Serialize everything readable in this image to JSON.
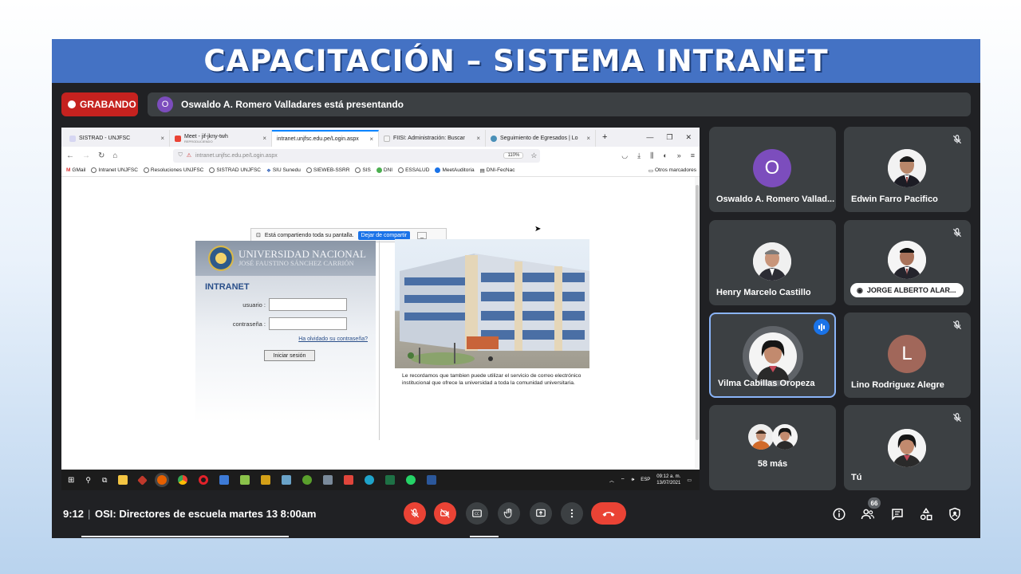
{
  "banner": {
    "title": "CAPACITACIÓN – SISTEMA INTRANET"
  },
  "meet": {
    "recording_label": "GRABANDO",
    "presenter_initial": "O",
    "presenter_text": "Oswaldo A. Romero Valladares está presentando",
    "time": "9:12",
    "divider": "|",
    "meeting_title": "OSI: Directores de escuela martes 13 8:00am",
    "participant_count": "66",
    "colors": {
      "background": "#202124",
      "tile": "#3c4043",
      "accent": "#1a73e8",
      "danger": "#ea4335",
      "banner": "#4472c4"
    }
  },
  "browser": {
    "tabs": [
      {
        "label": "SISTRAD - UNJFSC",
        "close": "×"
      },
      {
        "label": "Meet - jif-jkny-twh",
        "sub": "REPRODUCIENDO",
        "close": "×"
      },
      {
        "label": "intranet.unjfsc.edu.pe/Login.aspx",
        "close": "×"
      },
      {
        "label": "FIISI: Administración: Buscar",
        "close": "×"
      },
      {
        "label": "Seguimiento de Egresados | Lo",
        "close": "×"
      }
    ],
    "new_tab": "+",
    "url": "intranet.unjfsc.edu.pe/Login.aspx",
    "zoom": "110%",
    "bookmarks": [
      "GMail",
      "Intranet UNJFSC",
      "Resoluciones UNJFSC",
      "SISTRAD UNJFSC",
      "SIU Sunedu",
      "SIEWEB-SSRR",
      "SIS",
      "DNI",
      "ESSALUD",
      "MeetAuditoria",
      "DNI-FecNac"
    ],
    "other_bookmarks": "Otros marcadores",
    "share_notice": "Está compartiendo toda su pantalla.",
    "share_stop": "Dejar de compartir",
    "share_min": "_"
  },
  "login": {
    "uni_name": "UNIVERSIDAD NACIONAL",
    "uni_sub": "JOSÉ FAUSTINO SÁNCHEZ CARRIÓN",
    "section": "INTRANET",
    "user_label": "usuario :",
    "pass_label": "contraseña :",
    "forgot": "Ha olvidado su contraseña?",
    "submit": "Iniciar sesión",
    "note": "Le recordamos que tambien puede utilizar el servicio de correo electrónico institucional que ofrece la universidad a toda la comunidad universitaria."
  },
  "taskbar": {
    "lang": "ESP",
    "clock_time": "09:12 a. m.",
    "clock_date": "13/07/2021"
  },
  "participants": [
    {
      "name": "Oswaldo A. Romero Vallad...",
      "initial": "O",
      "avatar_color": "#7c4dbd",
      "muted": false
    },
    {
      "name": "Edwin Farro Pacifico",
      "muted": true
    },
    {
      "name": "Henry Marcelo Castillo",
      "muted": false
    },
    {
      "name": "JORGE ALBERTO ALAR...",
      "muted": true
    },
    {
      "name": "Vilma Cabillas Oropeza",
      "speaking": true
    },
    {
      "name": "Lino Rodriguez Alegre",
      "initial": "L",
      "avatar_color": "#a1675a",
      "muted": true
    },
    {
      "more": "58 más"
    },
    {
      "name": "Tú",
      "muted": true
    }
  ]
}
